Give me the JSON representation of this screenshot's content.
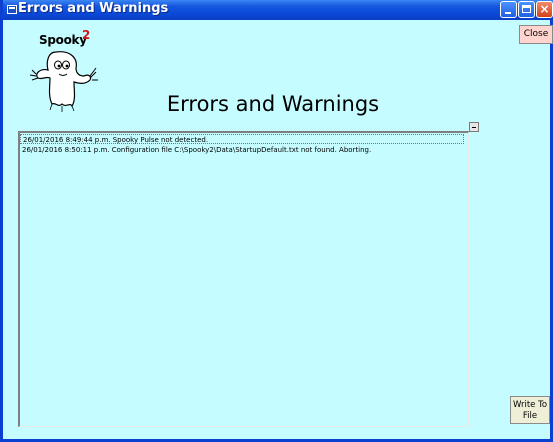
{
  "window": {
    "title": "Errors and Warnings",
    "controls": {
      "minimize": "minimize",
      "maximize": "maximize",
      "close": "×"
    }
  },
  "logo": {
    "text": "Spooky",
    "superscript": "2",
    "icon": "ghost-icon"
  },
  "heading": "Errors and Warnings",
  "buttons": {
    "close": "Close",
    "write_line1": "Write To",
    "write_line2": "File"
  },
  "log": {
    "entries": [
      "26/01/2016 8:49:44 p.m. Spooky Pulse not detected.",
      "26/01/2016 8:50:11 p.m. Configuration file C:\\Spooky2\\Data\\StartupDefault.txt not found. Aborting."
    ],
    "selected_index": 0
  },
  "colors": {
    "background": "#c4fcff",
    "titlebar": "#0a48d6",
    "close_button_bg": "#ffd4cf",
    "write_button_bg": "#efefd8"
  }
}
